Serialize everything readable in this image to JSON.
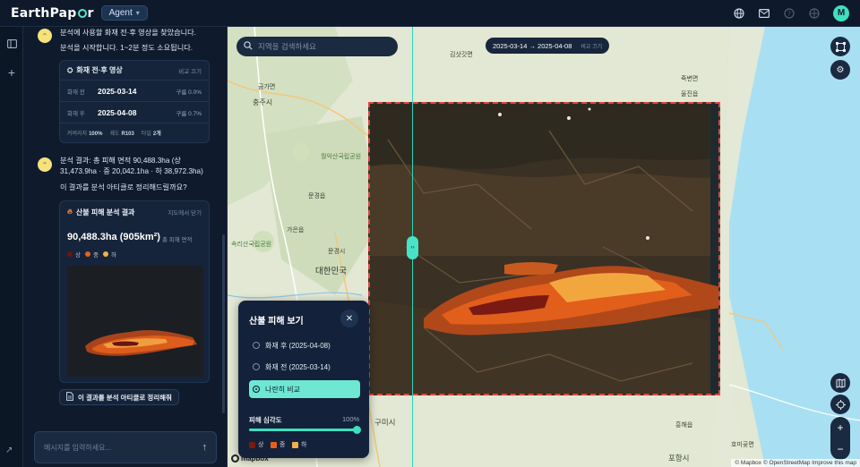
{
  "header": {
    "logo_pre": "EarthPap",
    "logo_post": "r",
    "agent_label": "Agent",
    "avatar_initial": "M",
    "icons": [
      "globe-grid-icon",
      "mail-icon",
      "help-icon",
      "language-icon"
    ]
  },
  "chat": {
    "messages": [
      {
        "text1": "분석에 사용할 화재 전·후 영상을 찾았습니다.",
        "text2": "분석을 시작합니다. 1~2분 정도 소요됩니다."
      },
      {
        "text1": "분석 결과: 총 피해 면적 90,488.3ha (상",
        "text2": "31,473.9ha · 중 20,042.1ha · 하 38,972.3ha)",
        "text3": "이 결과를 분석 아티클로 정리해드릴까요?"
      }
    ],
    "imagery_card": {
      "title": "화재 전·후 영상",
      "action": "비교 끄기",
      "rows": [
        {
          "label": "화재 전",
          "date": "2025-03-14",
          "cloud": "구름 0.0%"
        },
        {
          "label": "화재 후",
          "date": "2025-04-08",
          "cloud": "구름 0.7%"
        }
      ],
      "coverage_label": "커버리지",
      "coverage_value": "100%",
      "orbit_label": "궤도",
      "orbit_value": "R103",
      "tiles_label": "타일",
      "tiles_value": "2개"
    },
    "result_card": {
      "title": "산불 피해 분석 결과",
      "action": "지도에서 닫기",
      "area": "90,488.3ha (905km²)",
      "area_unit": "총 피해 면적",
      "legend": [
        {
          "label": "상",
          "color": "#6b1410"
        },
        {
          "label": "중",
          "color": "#e8601c"
        },
        {
          "label": "하",
          "color": "#f2b04a"
        }
      ]
    },
    "article_button": "이 결과를 분석 아티클로 정리해줘",
    "input_placeholder": "메시지를 입력하세요..."
  },
  "map": {
    "search_placeholder": "지역을 검색하세요",
    "date_range": "2025-03-14 → 2025-04-08",
    "date_close": "비교 끄기",
    "labels": [
      {
        "text": "금가면"
      },
      {
        "text": "충주시"
      },
      {
        "text": "월악산국립공원"
      },
      {
        "text": "문경읍"
      },
      {
        "text": "가은읍"
      },
      {
        "text": "문경시"
      },
      {
        "text": "대한민국"
      },
      {
        "text": "속리산국립공원"
      },
      {
        "text": "구미시"
      },
      {
        "text": "포항시"
      },
      {
        "text": "울진읍"
      },
      {
        "text": "죽변면"
      },
      {
        "text": "흥해읍"
      },
      {
        "text": "호미곶면"
      },
      {
        "text": "김삿갓면"
      }
    ],
    "attribution": "© Mapbox © OpenStreetMap  Improve this map",
    "mapbox_label": "mapbox"
  },
  "fire_panel": {
    "title": "산불 피해 보기",
    "options": [
      {
        "label": "화재 후 (2025-04-08)",
        "selected": false
      },
      {
        "label": "화재 전 (2025-03-14)",
        "selected": false
      },
      {
        "label": "나란히 비교",
        "selected": true
      }
    ],
    "severity_label": "피해 심각도",
    "severity_value": "100%",
    "severity_fraction": 1.0,
    "legend": [
      {
        "label": "상",
        "color": "#7a1a12"
      },
      {
        "label": "중",
        "color": "#e8601c"
      },
      {
        "label": "하",
        "color": "#f2b04a"
      }
    ]
  }
}
